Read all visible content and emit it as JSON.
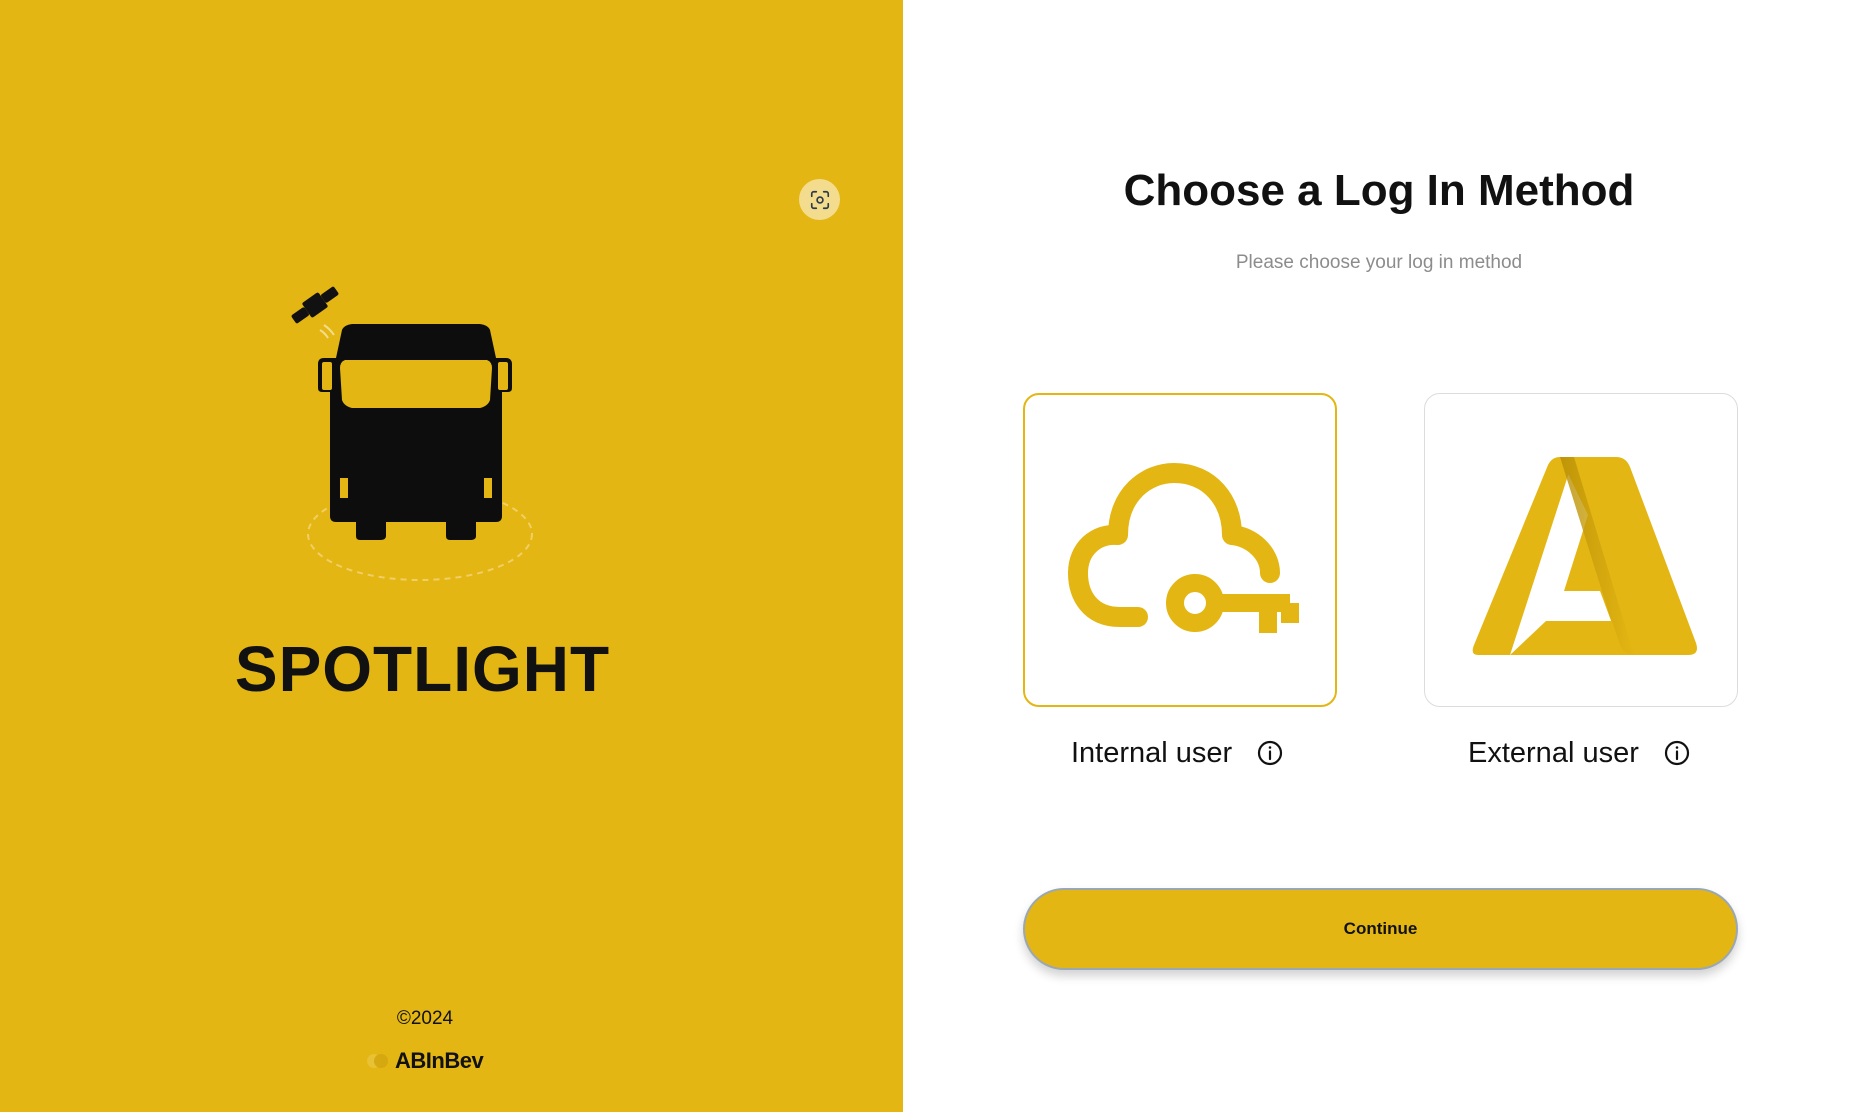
{
  "brand": {
    "app_name": "SPOTLIGHT",
    "copyright": "©2024",
    "company_name": "ABInBev",
    "accent_color": "#E4B613"
  },
  "icons": {
    "scan": "scan-face-icon",
    "truck": "truck-satellite-logo",
    "internal": "cloud-key-icon",
    "external": "azure-logo-icon",
    "info": "info-icon"
  },
  "main": {
    "title": "Choose a Log In Method",
    "subtitle": "Please choose your log in method",
    "options": [
      {
        "label": "Internal user",
        "selected": true
      },
      {
        "label": "External user",
        "selected": false
      }
    ],
    "continue_label": "Continue"
  }
}
